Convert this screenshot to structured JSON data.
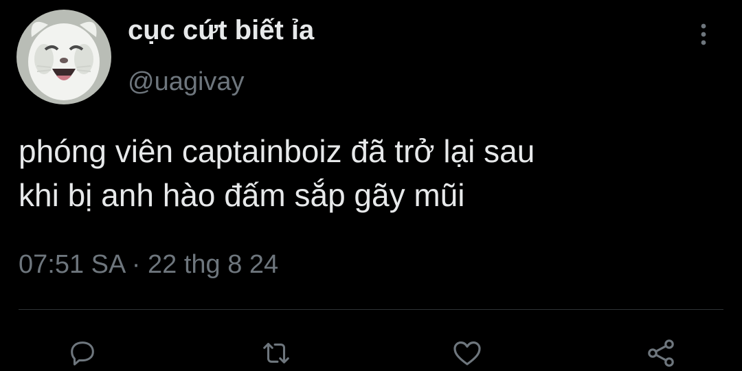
{
  "user": {
    "display_name": "cục cứt biết ỉa",
    "handle": "@uagivay",
    "avatar": "white-cat-avatar"
  },
  "tweet": {
    "text": "phóng viên captainboiz đã trở lại sau\nkhi bị anh hào đấm sắp gãy mũi",
    "timestamp": "07:51 SA · 22 thg 8 24"
  },
  "actions": [
    {
      "icon": "reply-icon"
    },
    {
      "icon": "retweet-icon"
    },
    {
      "icon": "like-icon"
    },
    {
      "icon": "share-icon"
    }
  ],
  "colors": {
    "background": "#000000",
    "text_primary": "#e7e9ea",
    "text_secondary": "#6e767d",
    "divider": "#2f3336"
  }
}
